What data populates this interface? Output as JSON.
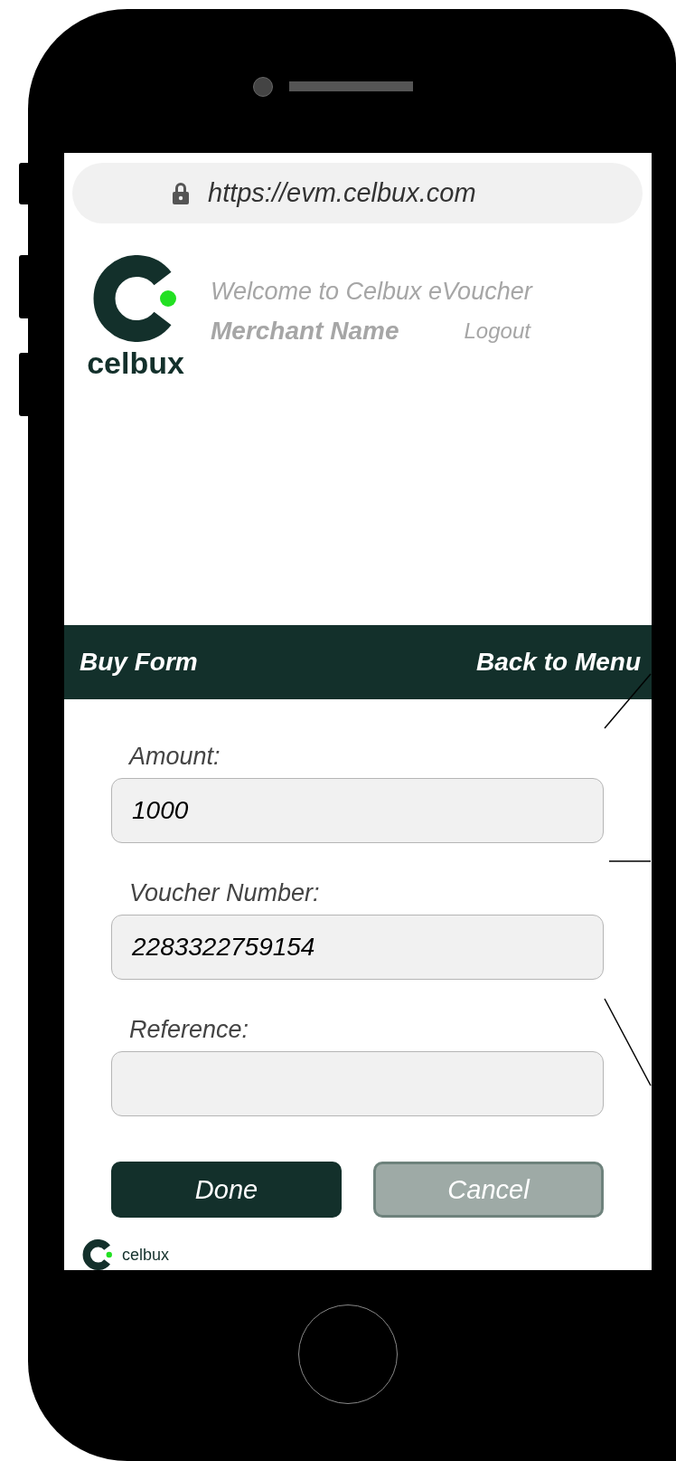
{
  "browser": {
    "url": "https://evm.celbux.com"
  },
  "header": {
    "logo_text": "celbux",
    "welcome": "Welcome to Celbux eVoucher",
    "merchant_name": "Merchant Name",
    "logout": "Logout"
  },
  "nav_bar": {
    "title": "Buy Form",
    "back_link": "Back to Menu"
  },
  "fields": [
    {
      "label": "Amount:",
      "value": "1000"
    },
    {
      "label": "Voucher Number:",
      "value": "2283322759154"
    },
    {
      "label": "Reference:"
    }
  ],
  "buttons": [
    {
      "label": "Done",
      "kind": "primary"
    },
    {
      "label": "Cancel",
      "kind": "secondary"
    }
  ],
  "footer": {
    "logo_text": "celbux"
  }
}
